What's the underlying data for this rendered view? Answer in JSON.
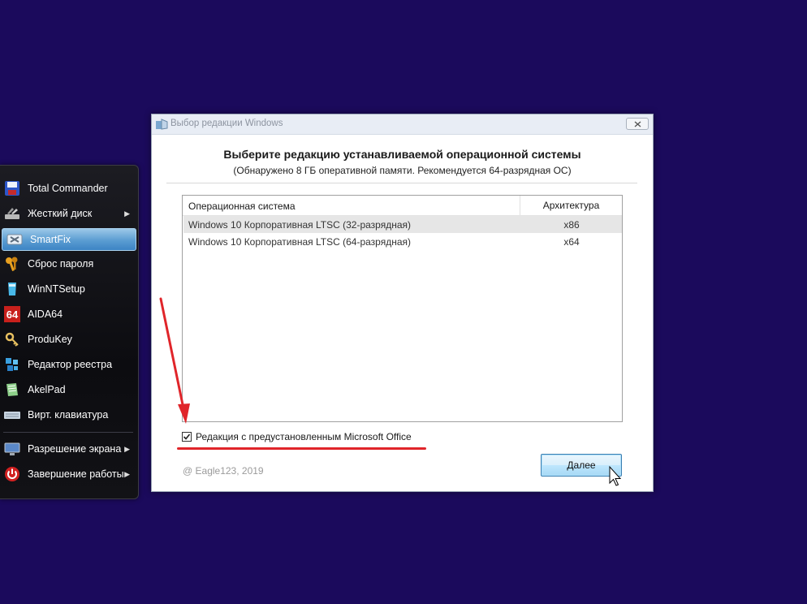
{
  "launcher": {
    "items": [
      {
        "label": "Total Commander",
        "icon": "floppy-disk-icon",
        "submenu": false
      },
      {
        "label": "Жесткий диск",
        "icon": "hard-disk-tools-icon",
        "submenu": true
      },
      {
        "label": "SmartFix",
        "icon": "smartfix-icon",
        "submenu": false,
        "selected": true
      },
      {
        "label": "Сброс пароля",
        "icon": "keys-icon",
        "submenu": false
      },
      {
        "label": "WinNTSetup",
        "icon": "winntsetup-icon",
        "submenu": false
      },
      {
        "label": "AIDA64",
        "icon": "aida64-icon",
        "submenu": false,
        "icon_text": "64"
      },
      {
        "label": "ProduKey",
        "icon": "key-icon",
        "submenu": false
      },
      {
        "label": "Редактор реестра",
        "icon": "registry-editor-icon",
        "submenu": false
      },
      {
        "label": "AkelPad",
        "icon": "notepad-icon",
        "submenu": false
      },
      {
        "label": "Вирт. клавиатура",
        "icon": "keyboard-icon",
        "submenu": false
      },
      {
        "label": "Разрешение экрана",
        "icon": "monitor-icon",
        "submenu": true
      },
      {
        "label": "Завершение работы",
        "icon": "power-icon",
        "submenu": true
      }
    ]
  },
  "dialog": {
    "title": "Выбор редакции Windows",
    "heading": "Выберите редакцию устанавливаемой операционной системы",
    "subheading": "(Обнаружено 8 ГБ оперативной памяти. Рекомендуется 64-разрядная ОС)",
    "table": {
      "columns": [
        "Операционная система",
        "Архитектура"
      ],
      "rows": [
        {
          "os": "Windows 10 Корпоративная LTSC (32-разрядная)",
          "arch": "x86",
          "selected": true
        },
        {
          "os": "Windows 10 Корпоративная LTSC (64-разрядная)",
          "arch": "x64",
          "selected": false
        }
      ]
    },
    "office_checkbox": {
      "label": "Редакция с предустановленным Microsoft Office",
      "checked": true
    },
    "copyright": "@ Eagle123, 2019",
    "next_button": "Далее"
  },
  "colors": {
    "desktop": "#1b0a5c",
    "annotation": "#e0252a",
    "menu_selected": "#5a9cd2"
  }
}
